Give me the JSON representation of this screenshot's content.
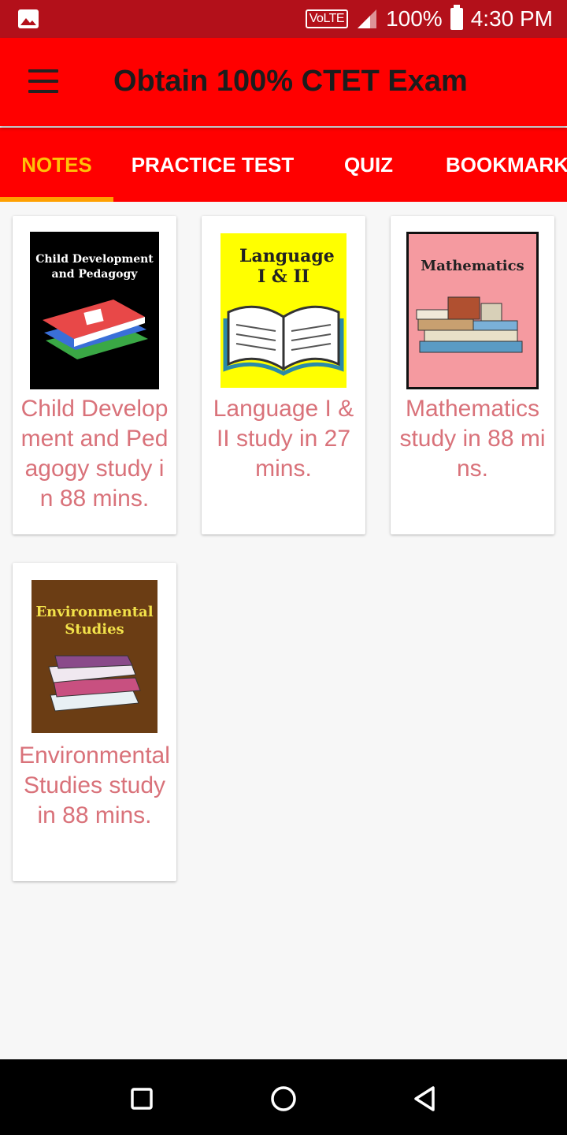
{
  "status_bar": {
    "volte": "VoLTE",
    "battery": "100%",
    "time": "4:30 PM",
    "icons": [
      "image-notification-icon",
      "signal-icon",
      "battery-icon"
    ]
  },
  "app_bar": {
    "title": "Obtain 100% CTET Exam",
    "menu_icon": "hamburger-menu-icon"
  },
  "tabs": [
    {
      "label": "NOTES",
      "active": true
    },
    {
      "label": "PRACTICE TEST",
      "active": false
    },
    {
      "label": "QUIZ",
      "active": false
    },
    {
      "label": "BOOKMARK",
      "active": false
    }
  ],
  "cards": [
    {
      "cover_title": "Child Development and Pedagogy",
      "cover_color": "#000000",
      "caption": "Child Development and Pedagogy study in 88 mins."
    },
    {
      "cover_title": "Language I & II",
      "cover_color": "#ffff00",
      "caption": "Language I & II study in 27 mins."
    },
    {
      "cover_title": "Mathematics",
      "cover_color": "#f59aa0",
      "caption": "Mathematics study in 88 mins."
    },
    {
      "cover_title": "Environmental Studies",
      "cover_color": "#6b3d14",
      "caption": "Environmental Studies study in 88 mins."
    }
  ],
  "colors": {
    "status_bar": "#b3101a",
    "app_bar": "#ff0000",
    "tab_active": "#ffc107",
    "caption": "#d9727a"
  },
  "nav_bar": {
    "buttons": [
      "recents-square-icon",
      "home-circle-icon",
      "back-triangle-icon"
    ]
  }
}
